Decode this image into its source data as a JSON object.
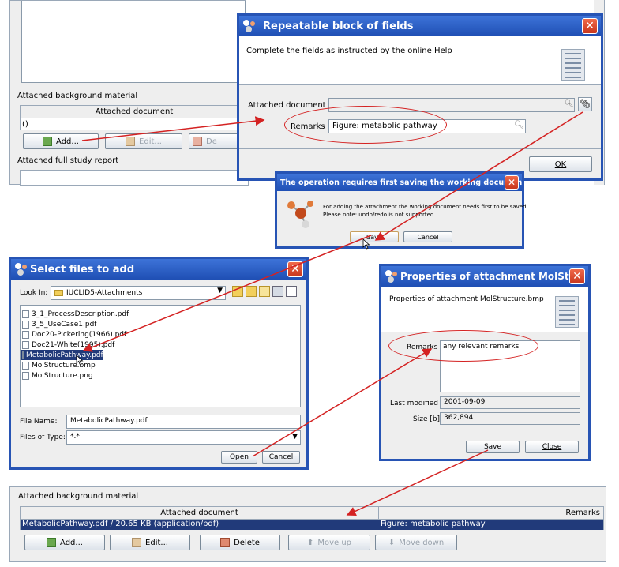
{
  "top_panel": {
    "section_background": "Attached background material",
    "col_attached_document": "Attached document",
    "row_value": "()",
    "add_button": "Add...",
    "edit_button": "Edit...",
    "delete_button_partial": "De",
    "section_full_study": "Attached full study report"
  },
  "repeatable_dialog": {
    "title": "Repeatable block of fields",
    "instruction": "Complete the fields as instructed by the online Help",
    "attached_document_label": "Attached document",
    "attached_document_value": "",
    "remarks_label": "Remarks",
    "remarks_value": "Figure: metabolic pathway",
    "ok_button": "OK"
  },
  "save_prompt": {
    "title": "The operation requires first saving the working document",
    "message_line1": "For adding the attachment the working document needs first to be saved",
    "message_line2": "Please note: undo/redo is not supported",
    "save_button": "Save",
    "cancel_button": "Cancel"
  },
  "file_dialog": {
    "title": "Select files to add",
    "look_in_label": "Look In:",
    "look_in_value": "IUCLID5-Attachments",
    "files": [
      {
        "name": "3_1_ProcessDescription.pdf",
        "selected": false
      },
      {
        "name": "3_5_UseCase1.pdf",
        "selected": false
      },
      {
        "name": "Doc20-Pickering(1966).pdf",
        "selected": false
      },
      {
        "name": "Doc21-White(1995).pdf",
        "selected": false
      },
      {
        "name": "MetabolicPathway.pdf",
        "selected": true
      },
      {
        "name": "MolStructure.bmp",
        "selected": false
      },
      {
        "name": "MolStructure.png",
        "selected": false
      }
    ],
    "file_name_label": "File Name:",
    "file_name_value": "MetabolicPathway.pdf",
    "files_of_type_label": "Files of Type:",
    "files_of_type_value": "*.*",
    "open_button": "Open",
    "cancel_button": "Cancel"
  },
  "properties_dialog": {
    "title": "Properties of attachment MolStr...",
    "description": "Properties of attachment MolStructure.bmp",
    "remarks_label": "Remarks",
    "remarks_value": "any relevant remarks",
    "last_modified_label": "Last modified",
    "last_modified_value": "2001-09-09",
    "size_label": "Size [b]",
    "size_value": "362,894",
    "save_button": "Save",
    "close_button": "Close"
  },
  "bottom_panel": {
    "section_background": "Attached background material",
    "col_attached_document": "Attached document",
    "col_remarks": "Remarks",
    "row_document": "MetabolicPathway.pdf / 20.65 KB (application/pdf)",
    "row_remarks": "Figure: metabolic pathway",
    "add_button": "Add...",
    "edit_button": "Edit...",
    "delete_button": "Delete",
    "move_up_button": "Move up",
    "move_down_button": "Move down"
  },
  "colors": {
    "title_blue": "#2754b4",
    "arrow_red": "#d42222",
    "selection_navy": "#213a7a"
  }
}
